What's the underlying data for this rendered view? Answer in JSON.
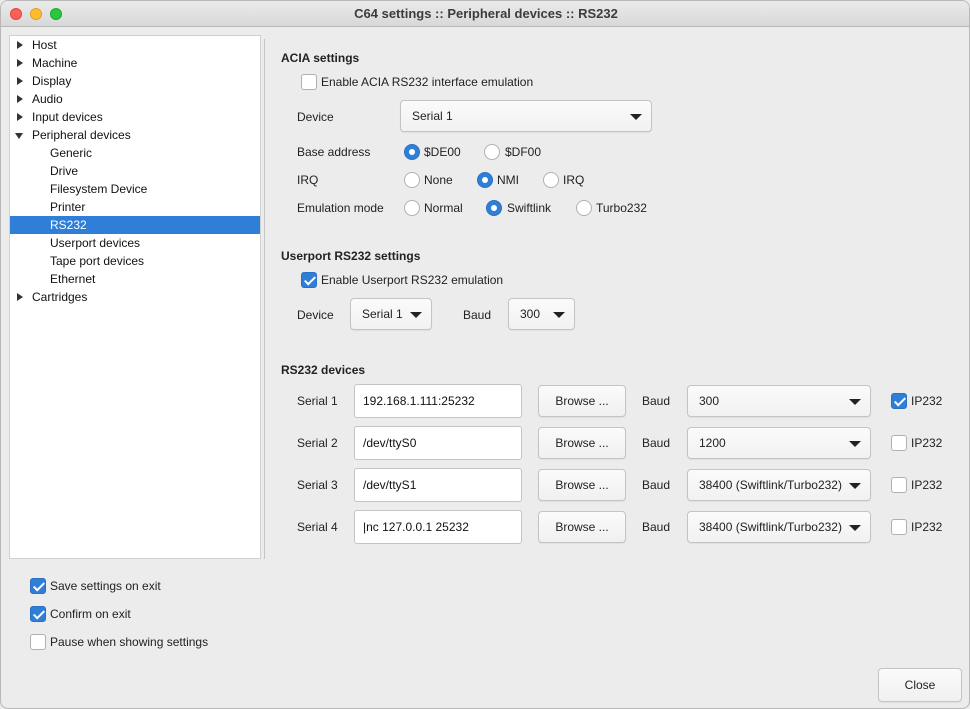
{
  "window": {
    "title": "C64 settings :: Peripheral devices :: RS232"
  },
  "tree": {
    "items": [
      {
        "label": "Host",
        "level": 0,
        "expander": "right",
        "selected": false
      },
      {
        "label": "Machine",
        "level": 0,
        "expander": "right",
        "selected": false
      },
      {
        "label": "Display",
        "level": 0,
        "expander": "right",
        "selected": false
      },
      {
        "label": "Audio",
        "level": 0,
        "expander": "right",
        "selected": false
      },
      {
        "label": "Input devices",
        "level": 0,
        "expander": "right",
        "selected": false
      },
      {
        "label": "Peripheral devices",
        "level": 0,
        "expander": "down",
        "selected": false
      },
      {
        "label": "Generic",
        "level": 1,
        "expander": "none",
        "selected": false
      },
      {
        "label": "Drive",
        "level": 1,
        "expander": "none",
        "selected": false
      },
      {
        "label": "Filesystem Device",
        "level": 1,
        "expander": "none",
        "selected": false
      },
      {
        "label": "Printer",
        "level": 1,
        "expander": "none",
        "selected": false
      },
      {
        "label": "RS232",
        "level": 1,
        "expander": "none",
        "selected": true
      },
      {
        "label": "Userport devices",
        "level": 1,
        "expander": "none",
        "selected": false
      },
      {
        "label": "Tape port devices",
        "level": 1,
        "expander": "none",
        "selected": false
      },
      {
        "label": "Ethernet",
        "level": 1,
        "expander": "none",
        "selected": false
      },
      {
        "label": "Cartridges",
        "level": 0,
        "expander": "right",
        "selected": false
      }
    ]
  },
  "acia": {
    "title": "ACIA settings",
    "enable_label": "Enable ACIA RS232 interface emulation",
    "enable_checked": false,
    "device_label": "Device",
    "device_value": "Serial 1",
    "base_label": "Base address",
    "base_options": [
      "$DE00",
      "$DF00"
    ],
    "irq_label": "IRQ",
    "irq_options": [
      "None",
      "NMI",
      "IRQ"
    ],
    "emu_label": "Emulation mode",
    "emu_options": [
      "Normal",
      "Swiftlink",
      "Turbo232"
    ]
  },
  "userport": {
    "title": "Userport RS232 settings",
    "enable_label": "Enable Userport RS232 emulation",
    "enable_checked": true,
    "device_label": "Device",
    "device_value": "Serial 1",
    "baud_label": "Baud",
    "baud_value": "300"
  },
  "devices": {
    "title": "RS232 devices",
    "browse_label": "Browse ...",
    "baud_label": "Baud",
    "ip_label": "IP232",
    "rows": [
      {
        "name": "Serial 1",
        "path": "192.168.1.111:25232",
        "baud": "300",
        "ip232": true
      },
      {
        "name": "Serial 2",
        "path": "/dev/ttyS0",
        "baud": "1200",
        "ip232": false
      },
      {
        "name": "Serial 3",
        "path": "/dev/ttyS1",
        "baud": "38400 (Swiftlink/Turbo232)",
        "ip232": false
      },
      {
        "name": "Serial 4",
        "path": "|nc 127.0.0.1 25232",
        "baud": "38400 (Swiftlink/Turbo232)",
        "ip232": false
      }
    ]
  },
  "footer": {
    "save_label": "Save settings on exit",
    "save_checked": true,
    "confirm_label": "Confirm on exit",
    "confirm_checked": true,
    "pause_label": "Pause when showing settings",
    "pause_checked": false,
    "close_label": "Close"
  },
  "colors": {
    "accent": "#2f7fd9"
  }
}
